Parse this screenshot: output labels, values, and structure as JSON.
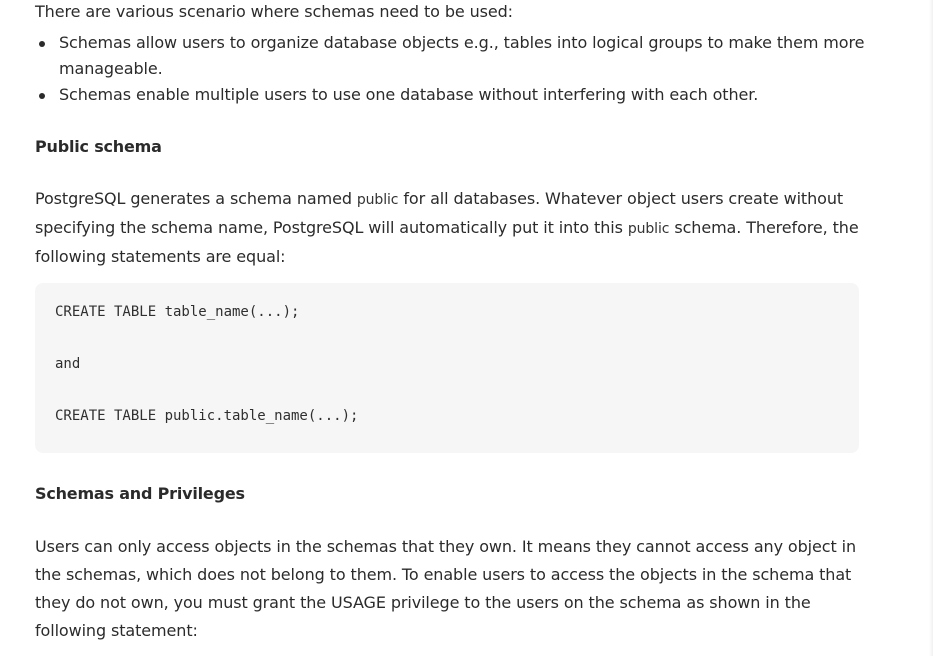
{
  "article": {
    "intro": "There are various scenario where schemas need to be used:",
    "bullets": [
      "Schemas allow users to organize database objects e.g., tables into logical groups to make them more manageable.",
      "Schemas enable multiple users to use one database without interfering with each other."
    ],
    "public_heading": "Public schema",
    "public_para": {
      "part1": "PostgreSQL generates a schema named ",
      "code1": "public",
      "part2": " for all databases. Whatever object users create without specifying the schema name, PostgreSQL will automatically put it into this ",
      "code2": "public",
      "part3": " schema. Therefore, the following statements are equal:"
    },
    "code_lines": [
      "CREATE TABLE table_name(...);",
      "and",
      "CREATE TABLE public.table_name(...);"
    ],
    "privileges_heading": "Schemas and Privileges",
    "privileges_para": "Users can only access objects in the schemas that they own. It means they cannot access any object in the schemas, which does not belong to them. To enable users to access the objects in the schema that they do not own, you must grant the USAGE privilege to the users on the schema as shown in the following statement:"
  }
}
